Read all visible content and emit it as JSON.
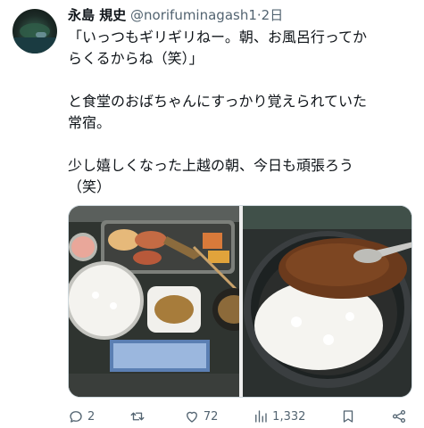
{
  "author": {
    "display_name": "永島 規史",
    "handle": "@norifuminagash1",
    "separator": "·",
    "timestamp": "2日"
  },
  "body": {
    "lines": [
      "「いっつもギリギリねー。朝、お風呂行ってか",
      "らくるからね（笑）」",
      "",
      "と食堂のおばちゃんにすっかり覚えられていた",
      "常宿。",
      "",
      "少し嬉しくなった上越の朝、今日も頑張ろう",
      "（笑）"
    ]
  },
  "media": {
    "images": [
      {
        "name": "breakfast-set-photo"
      },
      {
        "name": "curry-rice-photo"
      }
    ]
  },
  "actions": {
    "reply_count": "2",
    "retweet_count": "",
    "like_count": "72",
    "views_count": "1,332",
    "icons": [
      "reply-icon",
      "retweet-icon",
      "like-icon",
      "views-icon",
      "bookmark-icon",
      "share-icon"
    ]
  }
}
